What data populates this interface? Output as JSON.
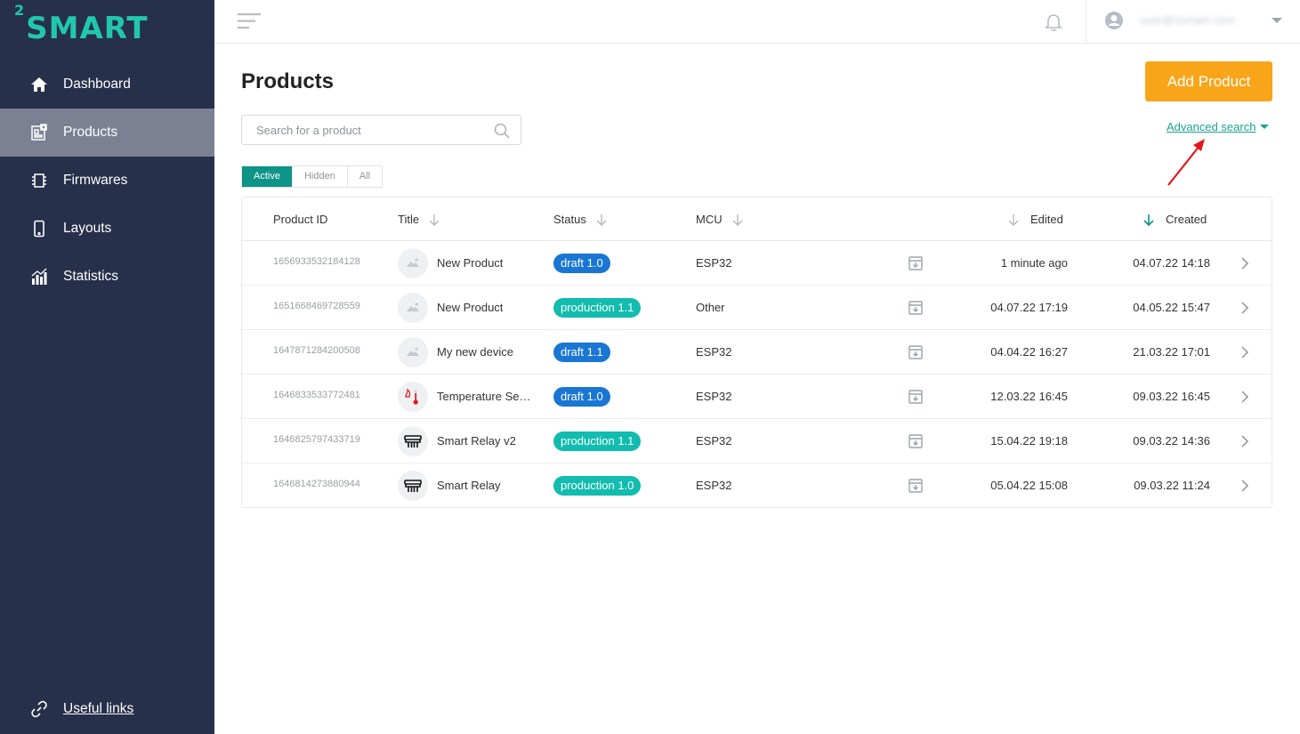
{
  "app": {
    "logo_prefix": "2",
    "logo_text": "SMART"
  },
  "sidebar": {
    "items": [
      {
        "label": "Dashboard",
        "icon": "home-icon",
        "active": false
      },
      {
        "label": "Products",
        "icon": "products-icon",
        "active": true
      },
      {
        "label": "Firmwares",
        "icon": "chip-icon",
        "active": false
      },
      {
        "label": "Layouts",
        "icon": "phone-icon",
        "active": false
      },
      {
        "label": "Statistics",
        "icon": "bar-chart-icon",
        "active": false
      }
    ],
    "useful_links_label": "Useful links"
  },
  "topbar": {
    "user_email": "user@2smart.com"
  },
  "page": {
    "title": "Products",
    "add_button": "Add Product",
    "search_placeholder": "Search for a product",
    "advanced_search": "Advanced search",
    "filters": [
      "Active",
      "Hidden",
      "All"
    ],
    "active_filter": "Active"
  },
  "table": {
    "headers": {
      "product_id": "Product ID",
      "title": "Title",
      "status": "Status",
      "mcu": "MCU",
      "edited": "Edited",
      "created": "Created"
    },
    "rows": [
      {
        "id": "1656933532184128",
        "title": "New Product",
        "thumb": "placeholder-image-icon",
        "status": "draft 1.0",
        "status_type": "draft",
        "mcu": "ESP32",
        "edited": "1 minute ago",
        "created": "04.07.22 14:18"
      },
      {
        "id": "1651668469728559",
        "title": "New Product",
        "thumb": "placeholder-image-icon",
        "status": "production 1.1",
        "status_type": "production",
        "mcu": "Other",
        "edited": "04.07.22 17:19",
        "created": "04.05.22 15:47"
      },
      {
        "id": "1647871284200508",
        "title": "My new device",
        "thumb": "placeholder-image-icon",
        "status": "draft 1.1",
        "status_type": "draft",
        "mcu": "ESP32",
        "edited": "04.04.22 16:27",
        "created": "21.03.22 17:01"
      },
      {
        "id": "1646833533772481",
        "title": "Temperature Sensor",
        "thumb": "thermometer-icon",
        "status": "draft 1.0",
        "status_type": "draft",
        "mcu": "ESP32",
        "edited": "12.03.22 16:45",
        "created": "09.03.22 16:45"
      },
      {
        "id": "1646825797433719",
        "title": "Smart Relay v2",
        "thumb": "relay-icon",
        "status": "production 1.1",
        "status_type": "production",
        "mcu": "ESP32",
        "edited": "15.04.22 19:18",
        "created": "09.03.22 14:36"
      },
      {
        "id": "1646814273880944",
        "title": "Smart Relay",
        "thumb": "relay-icon",
        "status": "production 1.0",
        "status_type": "production",
        "mcu": "ESP32",
        "edited": "05.04.22 15:08",
        "created": "09.03.22 11:24"
      }
    ]
  },
  "colors": {
    "sidebar_bg": "#27304a",
    "accent_teal": "#0f9488",
    "add_button": "#f9a51a",
    "draft_badge": "#1976d2",
    "production_badge": "#12bcae"
  }
}
